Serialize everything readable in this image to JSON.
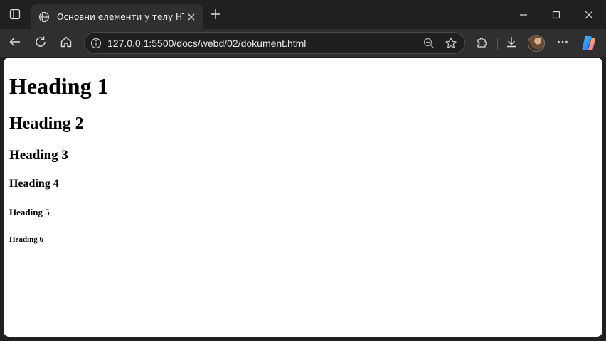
{
  "tab": {
    "title": "Основни елементи у телу HTML"
  },
  "address_bar": {
    "url": "127.0.0.1:5500/docs/webd/02/dokument.html"
  },
  "icons": {
    "tab_actions": "tab-actions-icon",
    "globe": "globe-icon",
    "close_tab": "close-icon",
    "new_tab": "plus-icon",
    "minimize": "minimize-icon",
    "maximize": "maximize-icon",
    "close_window": "close-window-icon",
    "back": "back-arrow-icon",
    "refresh": "refresh-icon",
    "home": "home-icon",
    "site_info": "info-icon",
    "zoom": "zoom-icon",
    "favorite": "star-icon",
    "extensions": "puzzle-icon",
    "downloads": "download-icon",
    "more": "more-icon",
    "copilot": "copilot-icon"
  },
  "page": {
    "h1": "Heading 1",
    "h2": "Heading 2",
    "h3": "Heading 3",
    "h4": "Heading 4",
    "h5": "Heading 5",
    "h6": "Heading 6"
  },
  "colors": {
    "chrome_dark": "#202020",
    "toolbar": "#2f2f2f",
    "page_bg": "#ffffff"
  }
}
